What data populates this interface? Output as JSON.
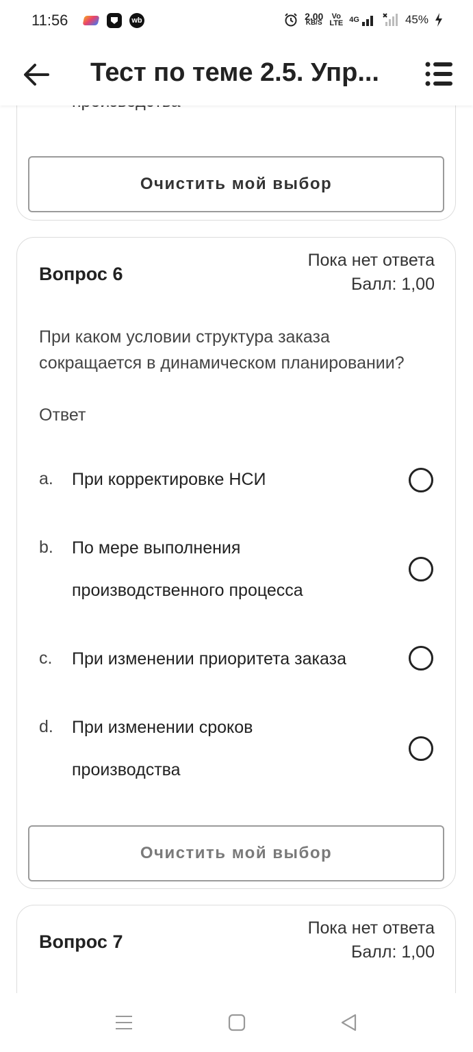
{
  "status_bar": {
    "time": "11:56",
    "net_speed_value": "2.00",
    "net_speed_unit": "KB/S",
    "volte_top": "Vo",
    "volte_bottom": "LTE",
    "network_type": "4G",
    "battery": "45%",
    "app_icons": [
      "colorful-app-icon",
      "shield-app-icon",
      "wb-app-icon"
    ],
    "wb_label": "wb"
  },
  "app_bar": {
    "title": "Тест по теме 2.5. Упр..."
  },
  "previous_card": {
    "cut_text": "производства",
    "clear_button": "Очистить мой выбор"
  },
  "question6": {
    "title": "Вопрос 6",
    "status": "Пока нет ответа",
    "score": "Балл: 1,00",
    "text": "При каком условии структура заказа сокращается в динамическом планировании?",
    "answer_label": "Ответ",
    "options": [
      {
        "letter": "a.",
        "text": "При корректировке НСИ"
      },
      {
        "letter": "b.",
        "text": "По мере выполнения производственного процесса"
      },
      {
        "letter": "c.",
        "text": "При изменении приоритета заказа"
      },
      {
        "letter": "d.",
        "text": "При изменении сроков производства"
      }
    ],
    "clear_button": "Очистить мой выбор"
  },
  "question7": {
    "title": "Вопрос 7",
    "status": "Пока нет ответа",
    "score": "Балл: 1,00"
  },
  "colors": {
    "text_dark": "#222222",
    "text_muted": "#444444",
    "clear_active": "#333333",
    "clear_disabled": "#7a7a7a",
    "card_border": "#dcdcdc"
  }
}
